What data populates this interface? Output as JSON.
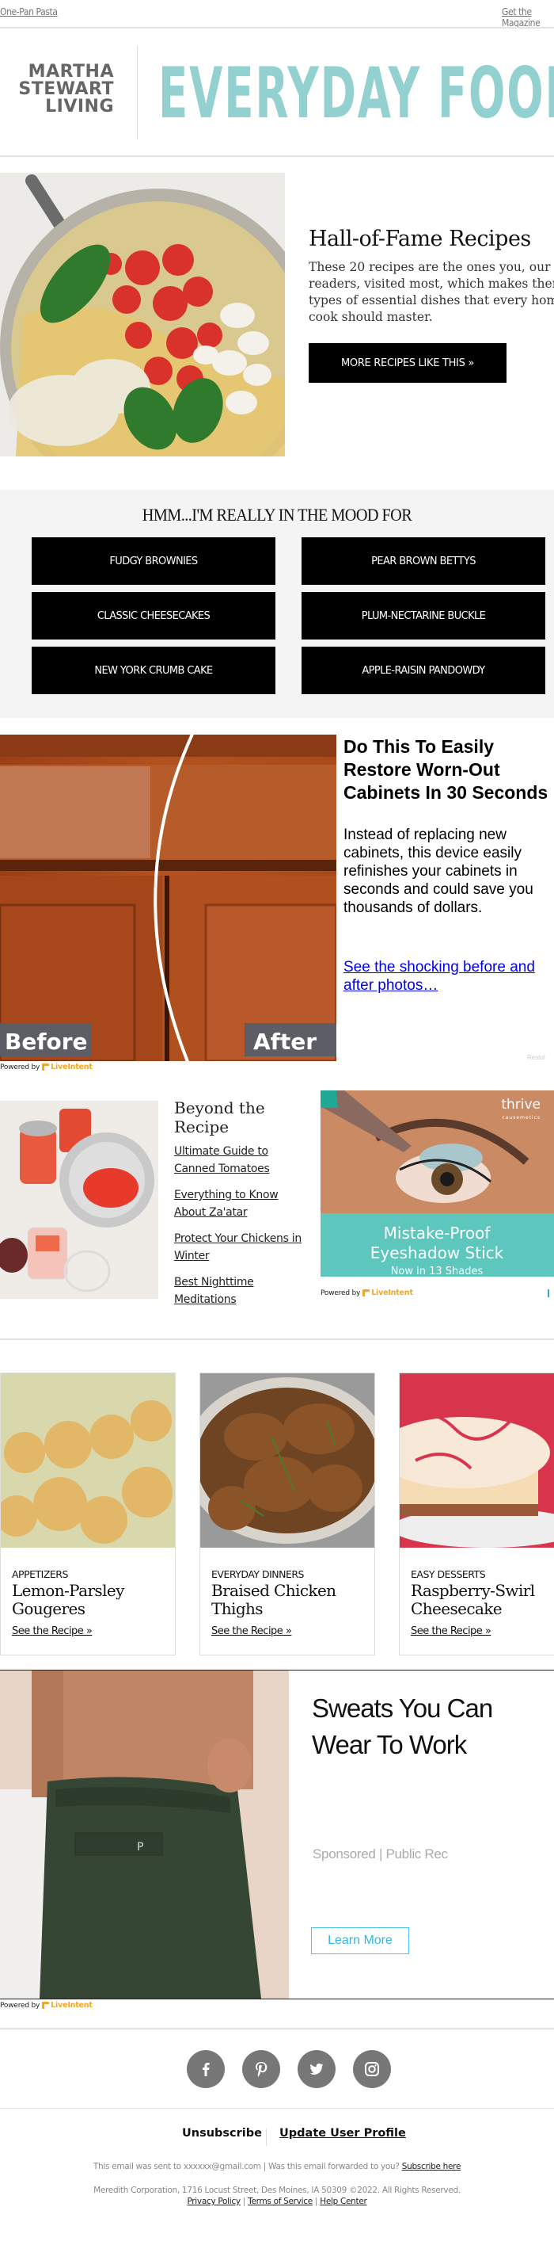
{
  "top_links": {
    "left": "One-Pan Pasta",
    "right": "Get the Magazine"
  },
  "logo": {
    "brand_lines": [
      "MARTHA",
      "STEWART",
      "LIVING"
    ],
    "publication": "EVERYDAY FOOD"
  },
  "hero": {
    "title": "Hall-of-Fame Recipes",
    "description_lines": [
      "These 20 recipes are the ones you, our",
      "readers, visited most, which makes them the",
      "types of essential dishes that every home",
      "cook should master."
    ],
    "button_label": "MORE RECIPES LIKE THIS »",
    "image_alt": "one-pan pasta with tomatoes, basil, onion and garlic"
  },
  "mood": {
    "title": "HMM...I'M REALLY IN THE MOOD FOR",
    "buttons": [
      "FUDGY BROWNIES",
      "PEAR BROWN BETTYS",
      "CLASSIC CHEESECAKES",
      "PLUM-NECTARINE BUCKLE",
      "NEW YORK CRUMB CAKE",
      "APPLE-RAISIN PANDOWDY"
    ]
  },
  "cabinet_ad": {
    "before_label": "Before",
    "after_label": "After",
    "title_lines": [
      "Do This To Easily",
      "Restore Worn-Out",
      "Cabinets In 30 Seconds"
    ],
    "description": "Instead of replacing new cabinets, this device easily refinishes your cabinets in seconds and could save you thousands of dollars.",
    "link": "See the shocking before and after photos…",
    "advertiser": "Restol",
    "powered_by": "Powered by",
    "powered_brand": "LiveIntent"
  },
  "beyond": {
    "title": "Beyond the Recipe",
    "links": [
      "Ultimate Guide to Canned Tomatoes",
      "Everything to Know About Za'atar",
      "Protect Your Chickens in Winter",
      "Best Nighttime Meditations"
    ]
  },
  "thrive_ad": {
    "brand": "thrive",
    "brand_sub": "causemetics",
    "headline_1": "Mistake-Proof",
    "headline_2": "Eyeshadow Stick",
    "subline": "Now in 13 Shades",
    "powered_by": "Powered by",
    "powered_brand": "LiveIntent"
  },
  "recipe_cards": [
    {
      "category": "APPETIZERS",
      "title": "Lemon-Parsley Gougeres",
      "link": "See the Recipe »"
    },
    {
      "category": "EVERYDAY DINNERS",
      "title": "Braised Chicken Thighs",
      "link": "See the Recipe »"
    },
    {
      "category": "EASY DESSERTS",
      "title": "Raspberry-Swirl Cheesecake",
      "link": "See the Recipe »"
    }
  ],
  "sweats_ad": {
    "title": "Sweats You Can Wear To Work",
    "sponsor": "Sponsored | Public Rec",
    "button_label": "Learn More",
    "powered_by": "Powered by",
    "powered_brand": "LiveIntent"
  },
  "social": [
    {
      "name": "facebook",
      "glyph": "f"
    },
    {
      "name": "pinterest",
      "glyph": "p"
    },
    {
      "name": "twitter",
      "glyph": "t"
    },
    {
      "name": "instagram",
      "glyph": "i"
    }
  ],
  "footer": {
    "unsubscribe": "Unsubscribe",
    "update_profile": "Update User Profile",
    "sent_to": "This email was sent to xxxxxx@gmail.com  |  Was this email forwarded to you?",
    "subscribe_here": "Subscribe here",
    "address": "Meredith Corporation, 1716 Locust Street, Des Moines, IA 50309 ©2022. All Rights Reserved.",
    "privacy": "Privacy Policy",
    "terms": "Terms of Service",
    "help": "Help Center",
    "sep": "|"
  },
  "colors": {
    "brand_teal": "#93d0d0",
    "thrive_teal": "#5dc6bd",
    "link_blue": "#0000ee",
    "liveintent_orange": "#f5a623",
    "learn_more_blue": "#33b6e4"
  }
}
